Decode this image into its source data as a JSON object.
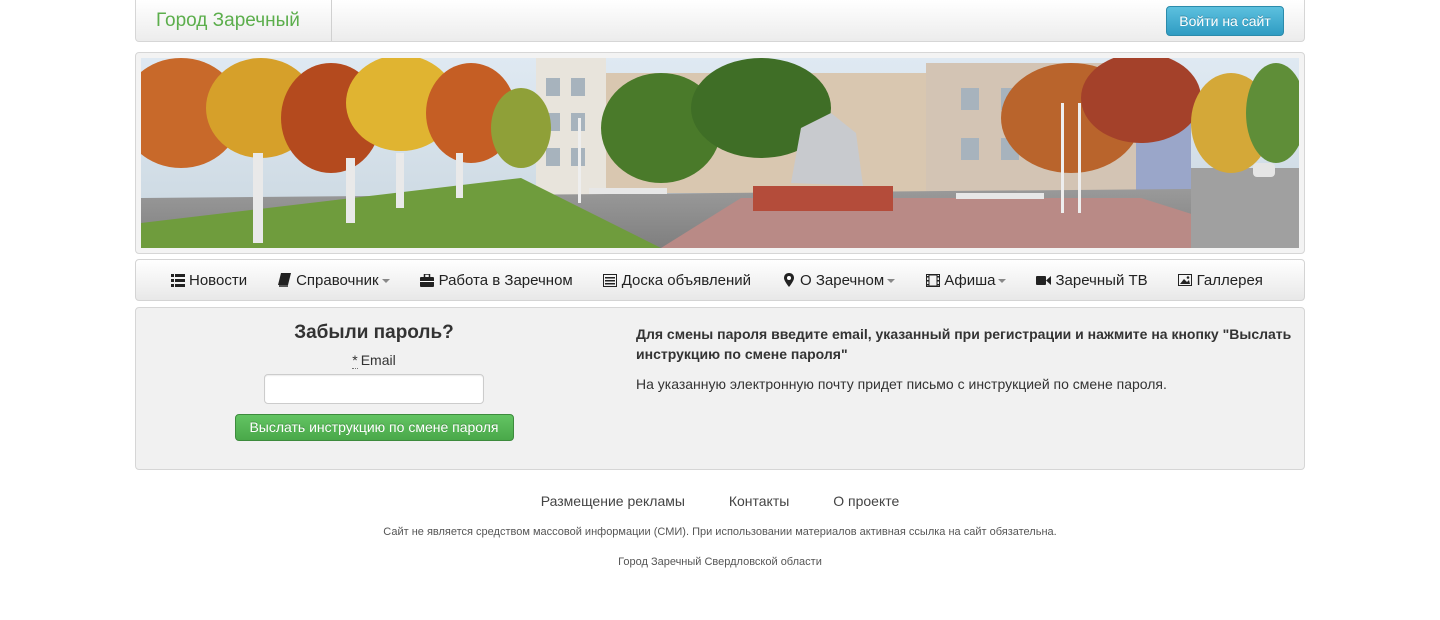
{
  "header": {
    "brand": "Город Заречный",
    "login_button": "Войти на сайт"
  },
  "banner": {
    "image": "town-panorama-autumn"
  },
  "menu": {
    "items": [
      {
        "label": "Новости",
        "icon": "list-icon",
        "dropdown": false
      },
      {
        "label": "Справочник",
        "icon": "book-icon",
        "dropdown": true
      },
      {
        "label": "Работа в Заречном",
        "icon": "briefcase-icon",
        "dropdown": false
      },
      {
        "label": "Доска объявлений",
        "icon": "list-alt-icon",
        "dropdown": false
      },
      {
        "label": "О Заречном",
        "icon": "map-marker-icon",
        "dropdown": true
      },
      {
        "label": "Афиша",
        "icon": "film-icon",
        "dropdown": true
      },
      {
        "label": "Заречный ТВ",
        "icon": "video-camera-icon",
        "dropdown": false
      },
      {
        "label": "Галлерея",
        "icon": "picture-icon",
        "dropdown": false
      }
    ]
  },
  "form": {
    "title": "Забыли пароль?",
    "required_mark": "*",
    "email_label": "Email",
    "email_value": "",
    "email_placeholder": "",
    "submit_label": "Выслать инструкцию по смене пароля"
  },
  "info": {
    "instruction": "Для смены пароля введите email, указанный при регистрации и нажмите на кнопку \"Выслать инструкцию по смене пароля\"",
    "note": "На указанную электронную почту придет письмо с инструкцией по смене пароля."
  },
  "footer": {
    "links": [
      "Размещение рекламы",
      "Контакты",
      "О проекте"
    ],
    "disclaimer": "Сайт не является средством массовой информации (СМИ). При использовании материалов активная ссылка на сайт обязательна.",
    "region": "Город Заречный Свердловской области"
  },
  "colors": {
    "brand": "#5cae4c",
    "login_button": "#2f9cc3",
    "submit_button": "#4aa84a",
    "panel_bg": "#f1f1f1"
  }
}
